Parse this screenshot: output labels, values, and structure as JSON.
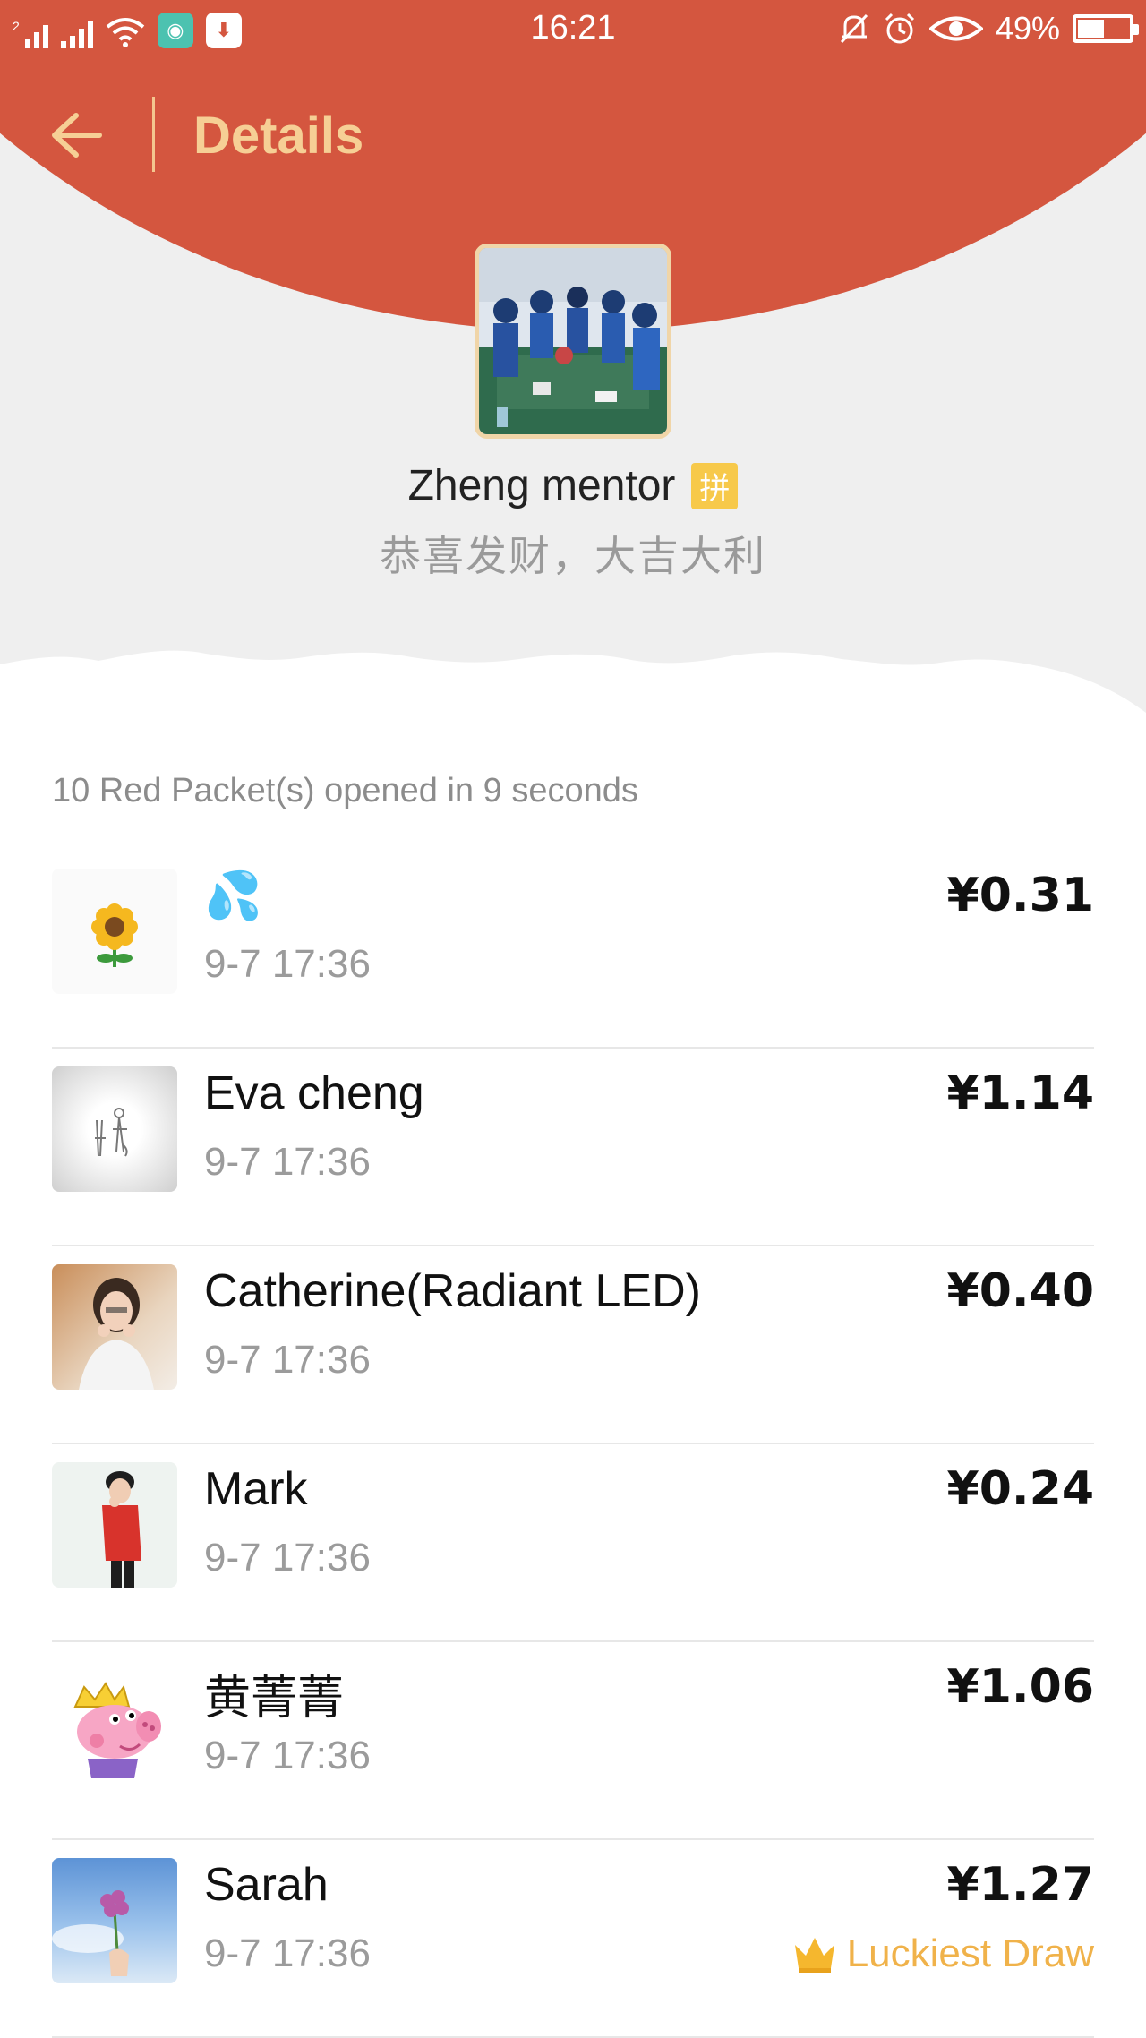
{
  "status_bar": {
    "time": "16:21",
    "sim_label": "2",
    "battery_label": "49%",
    "battery_level": 0.49
  },
  "toolbar": {
    "title": "Details"
  },
  "sender": {
    "name": "Zheng mentor",
    "badge": "拼",
    "wish": "恭喜发财，大吉大利"
  },
  "summary": "10 Red Packet(s) opened in 9 seconds",
  "luckiest_label": "Luckiest Draw",
  "records": [
    {
      "name": "💦",
      "time": "9-7  17:36",
      "amount": "¥0.31",
      "avatar": "sunflower-avatar"
    },
    {
      "name": "Eva cheng",
      "time": "9-7  17:36",
      "amount": "¥1.14",
      "avatar": "sketch-avatar"
    },
    {
      "name": "Catherine(Radiant LED)",
      "time": "9-7  17:36",
      "amount": "¥0.40",
      "avatar": "photo-woman-avatar"
    },
    {
      "name": "Mark",
      "time": "9-7  17:36",
      "amount": "¥0.24",
      "avatar": "photo-man-avatar"
    },
    {
      "name": "黄菁菁",
      "time": "9-7  17:36",
      "amount": "¥1.06",
      "avatar": "pig-avatar"
    },
    {
      "name": "Sarah",
      "time": "9-7  17:36",
      "amount": "¥1.27",
      "avatar": "flower-sky-avatar",
      "luckiest": true
    }
  ],
  "colors": {
    "header_red": "#d4563f",
    "title_gold": "#f6cf95",
    "luckiest_gold": "#f0b24a"
  }
}
